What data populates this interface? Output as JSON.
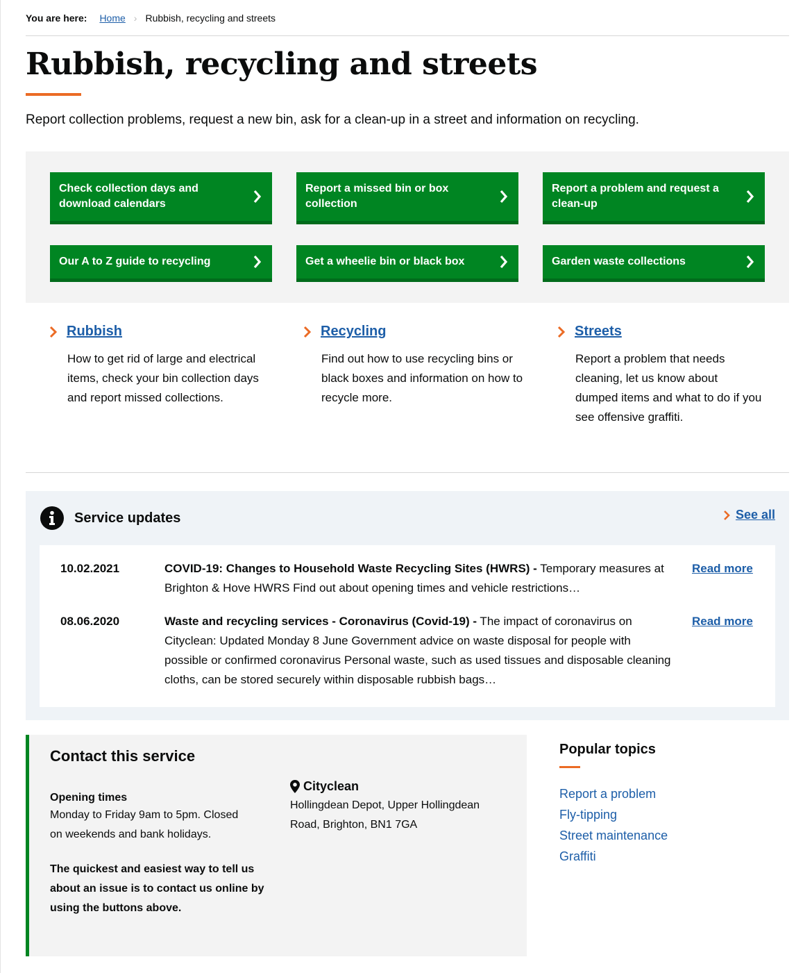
{
  "breadcrumb": {
    "label": "You are here:",
    "items": [
      {
        "label": "Home",
        "link": true
      },
      {
        "label": "Rubbish, recycling and streets",
        "link": false
      }
    ]
  },
  "page": {
    "title": "Rubbish, recycling and streets",
    "intro": "Report collection problems, request a new bin, ask for a clean-up in a street and information on recycling."
  },
  "action_buttons": [
    {
      "label": "Check collection days and download calendars",
      "icon": "chevron-right-icon"
    },
    {
      "label": "Report a missed bin or box collection",
      "icon": "chevron-right-icon"
    },
    {
      "label": "Report a problem and request a clean-up",
      "icon": "chevron-right-icon"
    },
    {
      "label": "Our A to Z guide to recycling",
      "icon": "chevron-right-icon"
    },
    {
      "label": "Get a wheelie bin or black box",
      "icon": "chevron-right-icon"
    },
    {
      "label": "Garden waste collections",
      "icon": "chevron-right-icon"
    }
  ],
  "topics": [
    {
      "title": "Rubbish",
      "description": "How to get rid of large and electrical items, check your bin collection days and report missed collections."
    },
    {
      "title": "Recycling",
      "description": "Find out how to use recycling bins or black boxes and information on how to recycle more."
    },
    {
      "title": "Streets",
      "description": "Report a problem that needs cleaning, let us know about dumped items and what to do if you see offensive graffiti."
    }
  ],
  "service_updates": {
    "title": "Service updates",
    "icon": "info-icon",
    "see_all": "See all",
    "items": [
      {
        "date": "10.02.2021",
        "headline": "COVID-19: Changes to Household Waste Recycling Sites (HWRS) -",
        "summary": " Temporary measures at Brighton & Hove HWRS Find out about opening times and vehicle restrictions…",
        "read_more": "Read more"
      },
      {
        "date": "08.06.2020",
        "headline": "Waste and recycling services - Coronavirus (Covid-19) -",
        "summary": " The impact of coronavirus on Cityclean: Updated Monday 8 June Government advice on waste disposal for people with possible or confirmed coronavirus Personal waste, such as used tissues and disposable cleaning cloths, can be stored securely within disposable rubbish bags…",
        "read_more": "Read more"
      }
    ]
  },
  "contact": {
    "title": "Contact this service",
    "opening_heading": "Opening times",
    "opening_text": "Monday to Friday 9am to 5pm. Closed on weekends and bank holidays.",
    "quick_text": "The quickest and easiest way to tell us about an issue is to contact us online by using the buttons above.",
    "location_name": "Cityclean",
    "location_icon": "map-pin-icon",
    "address": "Hollingdean Depot, Upper Hollingdean Road, Brighton, BN1 7GA"
  },
  "popular_topics": {
    "title": "Popular topics",
    "links": [
      "Report a problem",
      "Fly-tipping",
      "Street maintenance",
      "Graffiti"
    ]
  },
  "colors": {
    "button_green": "#008522",
    "button_green_shadow": "#006b1b",
    "accent_orange": "#eb6b25",
    "link_blue": "#1d5ea8",
    "panel_grey": "#f3f3f3",
    "updates_bg": "#eff3f7"
  }
}
